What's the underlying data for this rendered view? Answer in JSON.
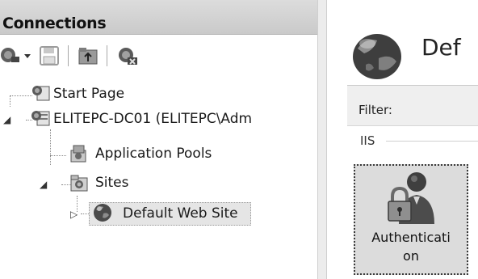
{
  "connections": {
    "title": "Connections",
    "toolbar": [
      {
        "name": "connect-icon",
        "label": ""
      },
      {
        "name": "save-icon",
        "label": ""
      },
      {
        "name": "up-folder-icon",
        "label": ""
      },
      {
        "name": "disconnect-icon",
        "label": ""
      }
    ]
  },
  "tree": {
    "start_page": "Start Page",
    "server": "ELITEPC-DC01 (ELITEPC\\Adm",
    "app_pools": "Application Pools",
    "sites": "Sites",
    "default_site": "Default Web Site",
    "expanded_glyph": "◢",
    "collapsed_glyph": "▷"
  },
  "main": {
    "title": "Def",
    "filter_label": "Filter:",
    "group_label": "IIS",
    "feature": {
      "line1": "Authenticati",
      "line2": "on",
      "icon": "authentication-icon"
    }
  },
  "colors": {
    "header_bg": "#d2d2d2",
    "selection_bg": "#e5e5e5",
    "tile_bg": "#dcdcdc"
  }
}
